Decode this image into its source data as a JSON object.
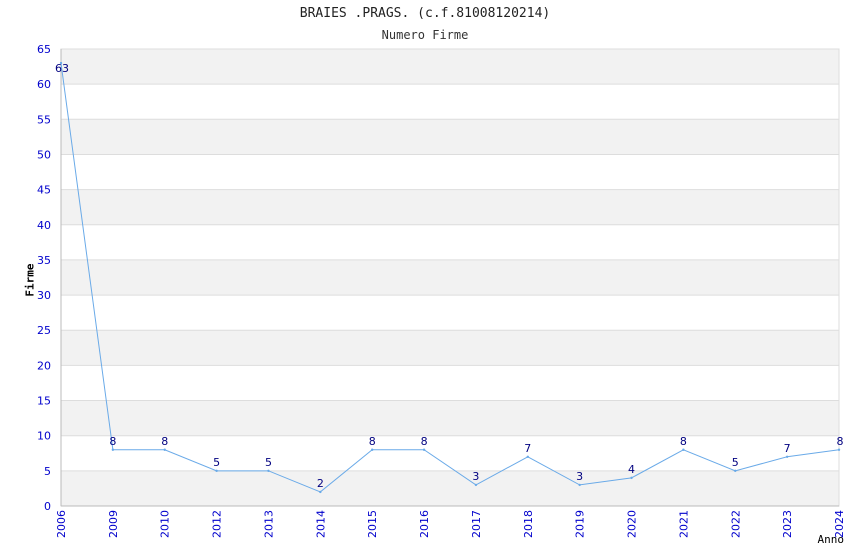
{
  "chart_data": {
    "type": "line",
    "title": "BRAIES .PRAGS. (c.f.81008120214)",
    "subtitle": "Numero Firme",
    "xlabel": "Anno",
    "ylabel": "Firme",
    "categories": [
      "2006",
      "2009",
      "2010",
      "2012",
      "2013",
      "2014",
      "2015",
      "2016",
      "2017",
      "2018",
      "2019",
      "2020",
      "2021",
      "2022",
      "2023",
      "2024"
    ],
    "series": [
      {
        "values": [
          63,
          8,
          8,
          5,
          5,
          2,
          8,
          8,
          3,
          7,
          3,
          4,
          8,
          5,
          7,
          8
        ]
      }
    ],
    "ylim": [
      0,
      65
    ],
    "yticks": [
      0,
      5,
      10,
      15,
      20,
      25,
      30,
      35,
      40,
      45,
      50,
      55,
      60,
      65
    ],
    "grid": true,
    "data_labels": true,
    "colors": {
      "line": "#6aaae8",
      "tick_text": "#0000cc",
      "label_text": "#000080",
      "band": "#f2f2f2",
      "gridline": "#dddddd"
    }
  }
}
